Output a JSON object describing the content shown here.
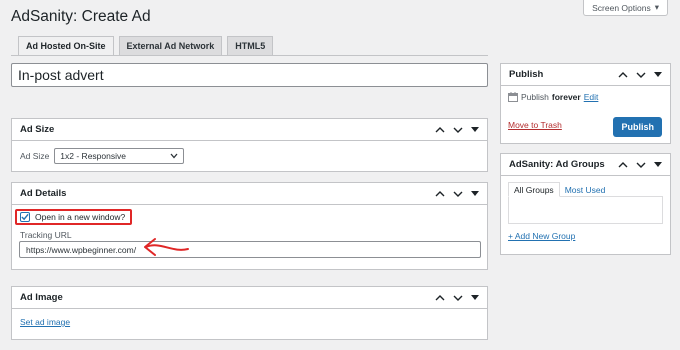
{
  "screen_options": {
    "label": "Screen Options"
  },
  "page": {
    "title": "AdSanity: Create Ad"
  },
  "tabs": [
    {
      "label": "Ad Hosted On-Site",
      "active": true
    },
    {
      "label": "External Ad Network",
      "active": false
    },
    {
      "label": "HTML5",
      "active": false
    }
  ],
  "title_field": {
    "value": "In-post advert"
  },
  "ad_size": {
    "title": "Ad Size",
    "field_label": "Ad Size",
    "selected": "1x2 - Responsive"
  },
  "ad_details": {
    "title": "Ad Details",
    "checkbox_label": "Open in a new window?",
    "checkbox_checked": true,
    "url_label": "Tracking URL",
    "url_value": "https://www.wpbeginner.com/"
  },
  "ad_image": {
    "title": "Ad Image",
    "link": "Set ad image"
  },
  "publish": {
    "title": "Publish",
    "status_prefix": "Publish",
    "status_value": "forever",
    "edit_link": "Edit",
    "trash_link": "Move to Trash",
    "button": "Publish"
  },
  "groups": {
    "title": "AdSanity: Ad Groups",
    "tab_all": "All Groups",
    "tab_used": "Most Used",
    "add_link": "+ Add New Group"
  },
  "colors": {
    "accent": "#2271b1",
    "annotation": "#e02727",
    "trash": "#b32d2e"
  }
}
